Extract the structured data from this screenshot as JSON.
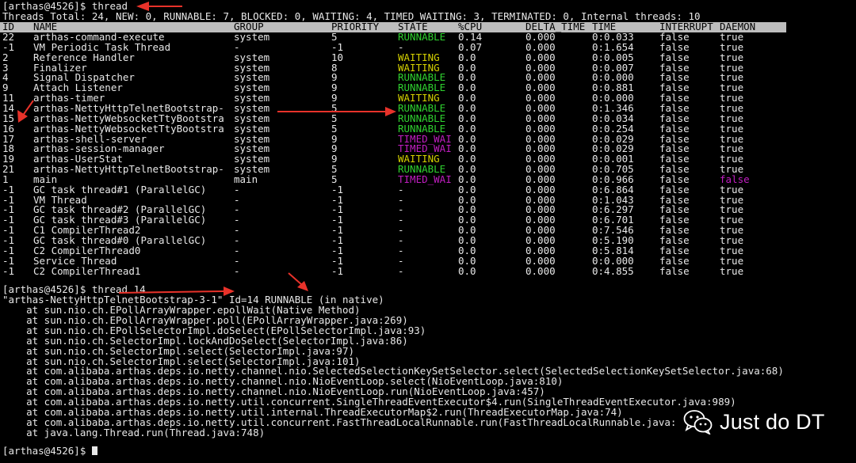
{
  "prompt1": "[arthas@4526]$ thread",
  "summary": "Threads Total: 24, NEW: 0, RUNNABLE: 7, BLOCKED: 0, WAITING: 4, TIMED_WAITING: 3, TERMINATED: 0, Internal threads: 10",
  "headers": [
    "ID",
    "NAME",
    "GROUP",
    "PRIORITY",
    "STATE",
    "%CPU",
    "DELTA_TIME",
    "TIME",
    "INTERRUPT",
    "DAEMON"
  ],
  "rows": [
    [
      "22",
      "arthas-command-execute",
      "system",
      "5",
      "RUNNABLE",
      "0.14",
      "0.000",
      "0:0.033",
      "false",
      "true"
    ],
    [
      "-1",
      "VM Periodic Task Thread",
      "-",
      "-1",
      "-",
      "0.07",
      "0.000",
      "0:1.654",
      "false",
      "true"
    ],
    [
      "2",
      "Reference Handler",
      "system",
      "10",
      "WAITING",
      "0.0",
      "0.000",
      "0:0.005",
      "false",
      "true"
    ],
    [
      "3",
      "Finalizer",
      "system",
      "8",
      "WAITING",
      "0.0",
      "0.000",
      "0:0.007",
      "false",
      "true"
    ],
    [
      "4",
      "Signal Dispatcher",
      "system",
      "9",
      "RUNNABLE",
      "0.0",
      "0.000",
      "0:0.000",
      "false",
      "true"
    ],
    [
      "9",
      "Attach Listener",
      "system",
      "9",
      "RUNNABLE",
      "0.0",
      "0.000",
      "0:0.881",
      "false",
      "true"
    ],
    [
      "11",
      "arthas-timer",
      "system",
      "9",
      "WAITING",
      "0.0",
      "0.000",
      "0:0.000",
      "false",
      "true"
    ],
    [
      "14",
      "arthas-NettyHttpTelnetBootstrap-",
      "system",
      "5",
      "RUNNABLE",
      "0.0",
      "0.000",
      "0:1.346",
      "false",
      "true"
    ],
    [
      "15",
      "arthas-NettyWebsocketTtyBootstra",
      "system",
      "5",
      "RUNNABLE",
      "0.0",
      "0.000",
      "0:0.034",
      "false",
      "true"
    ],
    [
      "16",
      "arthas-NettyWebsocketTtyBootstra",
      "system",
      "5",
      "RUNNABLE",
      "0.0",
      "0.000",
      "0:0.254",
      "false",
      "true"
    ],
    [
      "17",
      "arthas-shell-server",
      "system",
      "9",
      "TIMED_WAI",
      "0.0",
      "0.000",
      "0:0.029",
      "false",
      "true"
    ],
    [
      "18",
      "arthas-session-manager",
      "system",
      "9",
      "TIMED_WAI",
      "0.0",
      "0.000",
      "0:0.029",
      "false",
      "true"
    ],
    [
      "19",
      "arthas-UserStat",
      "system",
      "9",
      "WAITING",
      "0.0",
      "0.000",
      "0:0.001",
      "false",
      "true"
    ],
    [
      "21",
      "arthas-NettyHttpTelnetBootstrap-",
      "system",
      "5",
      "RUNNABLE",
      "0.0",
      "0.000",
      "0:0.705",
      "false",
      "true"
    ],
    [
      "1",
      "main",
      "main",
      "5",
      "TIMED_WAI",
      "0.0",
      "0.000",
      "0:0.966",
      "false",
      "false"
    ],
    [
      "-1",
      "GC task thread#1 (ParallelGC)",
      "-",
      "-1",
      "-",
      "0.0",
      "0.000",
      "0:6.864",
      "false",
      "true"
    ],
    [
      "-1",
      "VM Thread",
      "-",
      "-1",
      "-",
      "0.0",
      "0.000",
      "0:1.043",
      "false",
      "true"
    ],
    [
      "-1",
      "GC task thread#2 (ParallelGC)",
      "-",
      "-1",
      "-",
      "0.0",
      "0.000",
      "0:6.297",
      "false",
      "true"
    ],
    [
      "-1",
      "GC task thread#3 (ParallelGC)",
      "-",
      "-1",
      "-",
      "0.0",
      "0.000",
      "0:6.701",
      "false",
      "true"
    ],
    [
      "-1",
      "C1 CompilerThread2",
      "-",
      "-1",
      "-",
      "0.0",
      "0.000",
      "0:7.546",
      "false",
      "true"
    ],
    [
      "-1",
      "GC task thread#0 (ParallelGC)",
      "-",
      "-1",
      "-",
      "0.0",
      "0.000",
      "0:5.190",
      "false",
      "true"
    ],
    [
      "-1",
      "C2 CompilerThread0",
      "-",
      "-1",
      "-",
      "0.0",
      "0.000",
      "0:5.814",
      "false",
      "true"
    ],
    [
      "-1",
      "Service Thread",
      "-",
      "-1",
      "-",
      "0.0",
      "0.000",
      "0:0.000",
      "false",
      "true"
    ],
    [
      "-1",
      "C2 CompilerThread1",
      "-",
      "-1",
      "-",
      "0.0",
      "0.000",
      "0:4.855",
      "false",
      "true"
    ]
  ],
  "prompt2": "[arthas@4526]$ thread 14",
  "thread_detail": "\"arthas-NettyHttpTelnetBootstrap-3-1\" Id=14 RUNNABLE (in native)",
  "stack": [
    "    at sun.nio.ch.EPollArrayWrapper.epollWait(Native Method)",
    "    at sun.nio.ch.EPollArrayWrapper.poll(EPollArrayWrapper.java:269)",
    "    at sun.nio.ch.EPollSelectorImpl.doSelect(EPollSelectorImpl.java:93)",
    "    at sun.nio.ch.SelectorImpl.lockAndDoSelect(SelectorImpl.java:86)",
    "    at sun.nio.ch.SelectorImpl.select(SelectorImpl.java:97)",
    "    at sun.nio.ch.SelectorImpl.select(SelectorImpl.java:101)",
    "    at com.alibaba.arthas.deps.io.netty.channel.nio.SelectedSelectionKeySetSelector.select(SelectedSelectionKeySetSelector.java:68)",
    "    at com.alibaba.arthas.deps.io.netty.channel.nio.NioEventLoop.select(NioEventLoop.java:810)",
    "    at com.alibaba.arthas.deps.io.netty.channel.nio.NioEventLoop.run(NioEventLoop.java:457)",
    "    at com.alibaba.arthas.deps.io.netty.util.concurrent.SingleThreadEventExecutor$4.run(SingleThreadEventExecutor.java:989)",
    "    at com.alibaba.arthas.deps.io.netty.util.internal.ThreadExecutorMap$2.run(ThreadExecutorMap.java:74)",
    "    at com.alibaba.arthas.deps.io.netty.util.concurrent.FastThreadLocalRunnable.run(FastThreadLocalRunnable.java:",
    "    at java.lang.Thread.run(Thread.java:748)"
  ],
  "prompt3": "[arthas@4526]$ ",
  "watermark": {
    "text": "Just do DT",
    "icon": "wechat-icon"
  },
  "colors": {
    "background": "#000000",
    "text": "#e8e8e8",
    "header_bar": "#bdbdbd",
    "runnable": "#2fd12f",
    "waiting": "#d5d100",
    "timed_waiting": "#c21ec2",
    "annotation_arrow": "#e8322a"
  }
}
